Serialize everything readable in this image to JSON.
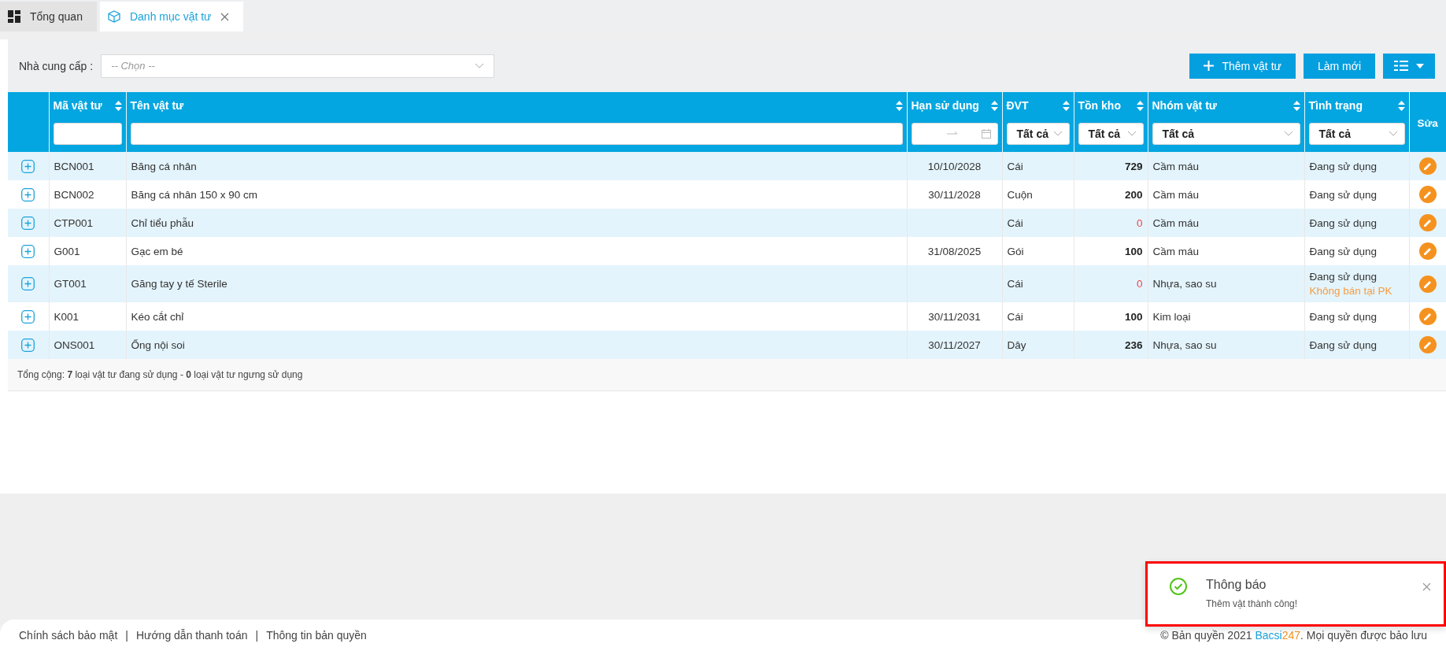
{
  "tabs": [
    {
      "label": "Tổng quan",
      "selected": false,
      "closable": false
    },
    {
      "label": "Danh mục vật tư",
      "selected": true,
      "closable": true
    }
  ],
  "toolbar": {
    "supplier_label": "Nhà cung cấp :",
    "supplier_placeholder": "-- Chọn --",
    "add_button": "Thêm vật tư",
    "refresh_button": "Làm mới"
  },
  "table": {
    "columns": [
      {
        "label": "Mã vật tư",
        "sortable": true,
        "filter": {
          "kind": "text"
        }
      },
      {
        "label": "Tên vật tư",
        "sortable": true,
        "filter": {
          "kind": "text"
        }
      },
      {
        "label": "Hạn sử dụng",
        "sortable": true,
        "filter": {
          "kind": "date_range"
        }
      },
      {
        "label": "ĐVT",
        "sortable": true,
        "filter": {
          "kind": "select",
          "value": "Tất cả"
        }
      },
      {
        "label": "Tồn kho",
        "sortable": true,
        "filter": {
          "kind": "select",
          "value": "Tất cả"
        }
      },
      {
        "label": "Nhóm vật tư",
        "sortable": true,
        "filter": {
          "kind": "select",
          "value": "Tất cả"
        }
      },
      {
        "label": "Tình trạng",
        "sortable": true,
        "filter": {
          "kind": "select",
          "value": "Tất cả"
        }
      },
      {
        "label": "Sửa",
        "sortable": false
      }
    ],
    "rows": [
      {
        "code": "BCN001",
        "name": "Băng cá nhân",
        "expiry": "10/10/2028",
        "unit": "Cái",
        "stock": "729",
        "stock_alert": false,
        "group": "Cầm máu",
        "status": "Đang sử dụng"
      },
      {
        "code": "BCN002",
        "name": "Băng cá nhân 150 x 90 cm",
        "expiry": "30/11/2028",
        "unit": "Cuộn",
        "stock": "200",
        "stock_alert": false,
        "group": "Cầm máu",
        "status": "Đang sử dụng"
      },
      {
        "code": "CTP001",
        "name": "Chỉ tiểu phẫu",
        "unit": "Cái",
        "stock": "0",
        "stock_alert": true,
        "group": "Cầm máu",
        "status": "Đang sử dụng"
      },
      {
        "code": "G001",
        "name": "Gạc em bé",
        "expiry": "31/08/2025",
        "unit": "Gói",
        "stock": "100",
        "stock_alert": false,
        "group": "Cầm máu",
        "status": "Đang sử dụng"
      },
      {
        "code": "GT001",
        "name": "Găng tay y tế Sterile",
        "unit": "Cái",
        "stock": "0",
        "stock_alert": true,
        "group": "Nhựa, sao su",
        "status": "Đang sử dụng",
        "note": "Không bán tại PK"
      },
      {
        "code": "K001",
        "name": "Kéo cắt chỉ",
        "expiry": "30/11/2031",
        "unit": "Cái",
        "stock": "100",
        "stock_alert": false,
        "group": "Kim loại",
        "status": "Đang sử dụng"
      },
      {
        "code": "ONS001",
        "name": "Ống nội soi",
        "expiry": "30/11/2027",
        "unit": "Dây",
        "stock": "236",
        "stock_alert": false,
        "group": "Nhựa, sao su",
        "status": "Đang sử dụng"
      }
    ],
    "summary": "Tổng cộng: **7** loại vật tư đang sử dụng - **0** loại vật tư ngưng sử dụng"
  },
  "footer": {
    "links": [
      "Chính sách bảo mật",
      "Hướng dẫn thanh toán",
      "Thông tin bản quyền"
    ],
    "separator": "|",
    "copyright_prefix": "© Bản quyền 2021",
    "brand_first": "Bacsi",
    "brand_second": "247",
    "copyright_suffix": ". Mọi quyền được bảo lưu"
  },
  "toast": {
    "kind": "success",
    "title": "Thông báo",
    "message": "Thêm vật thành công!",
    "highlighted": true
  }
}
